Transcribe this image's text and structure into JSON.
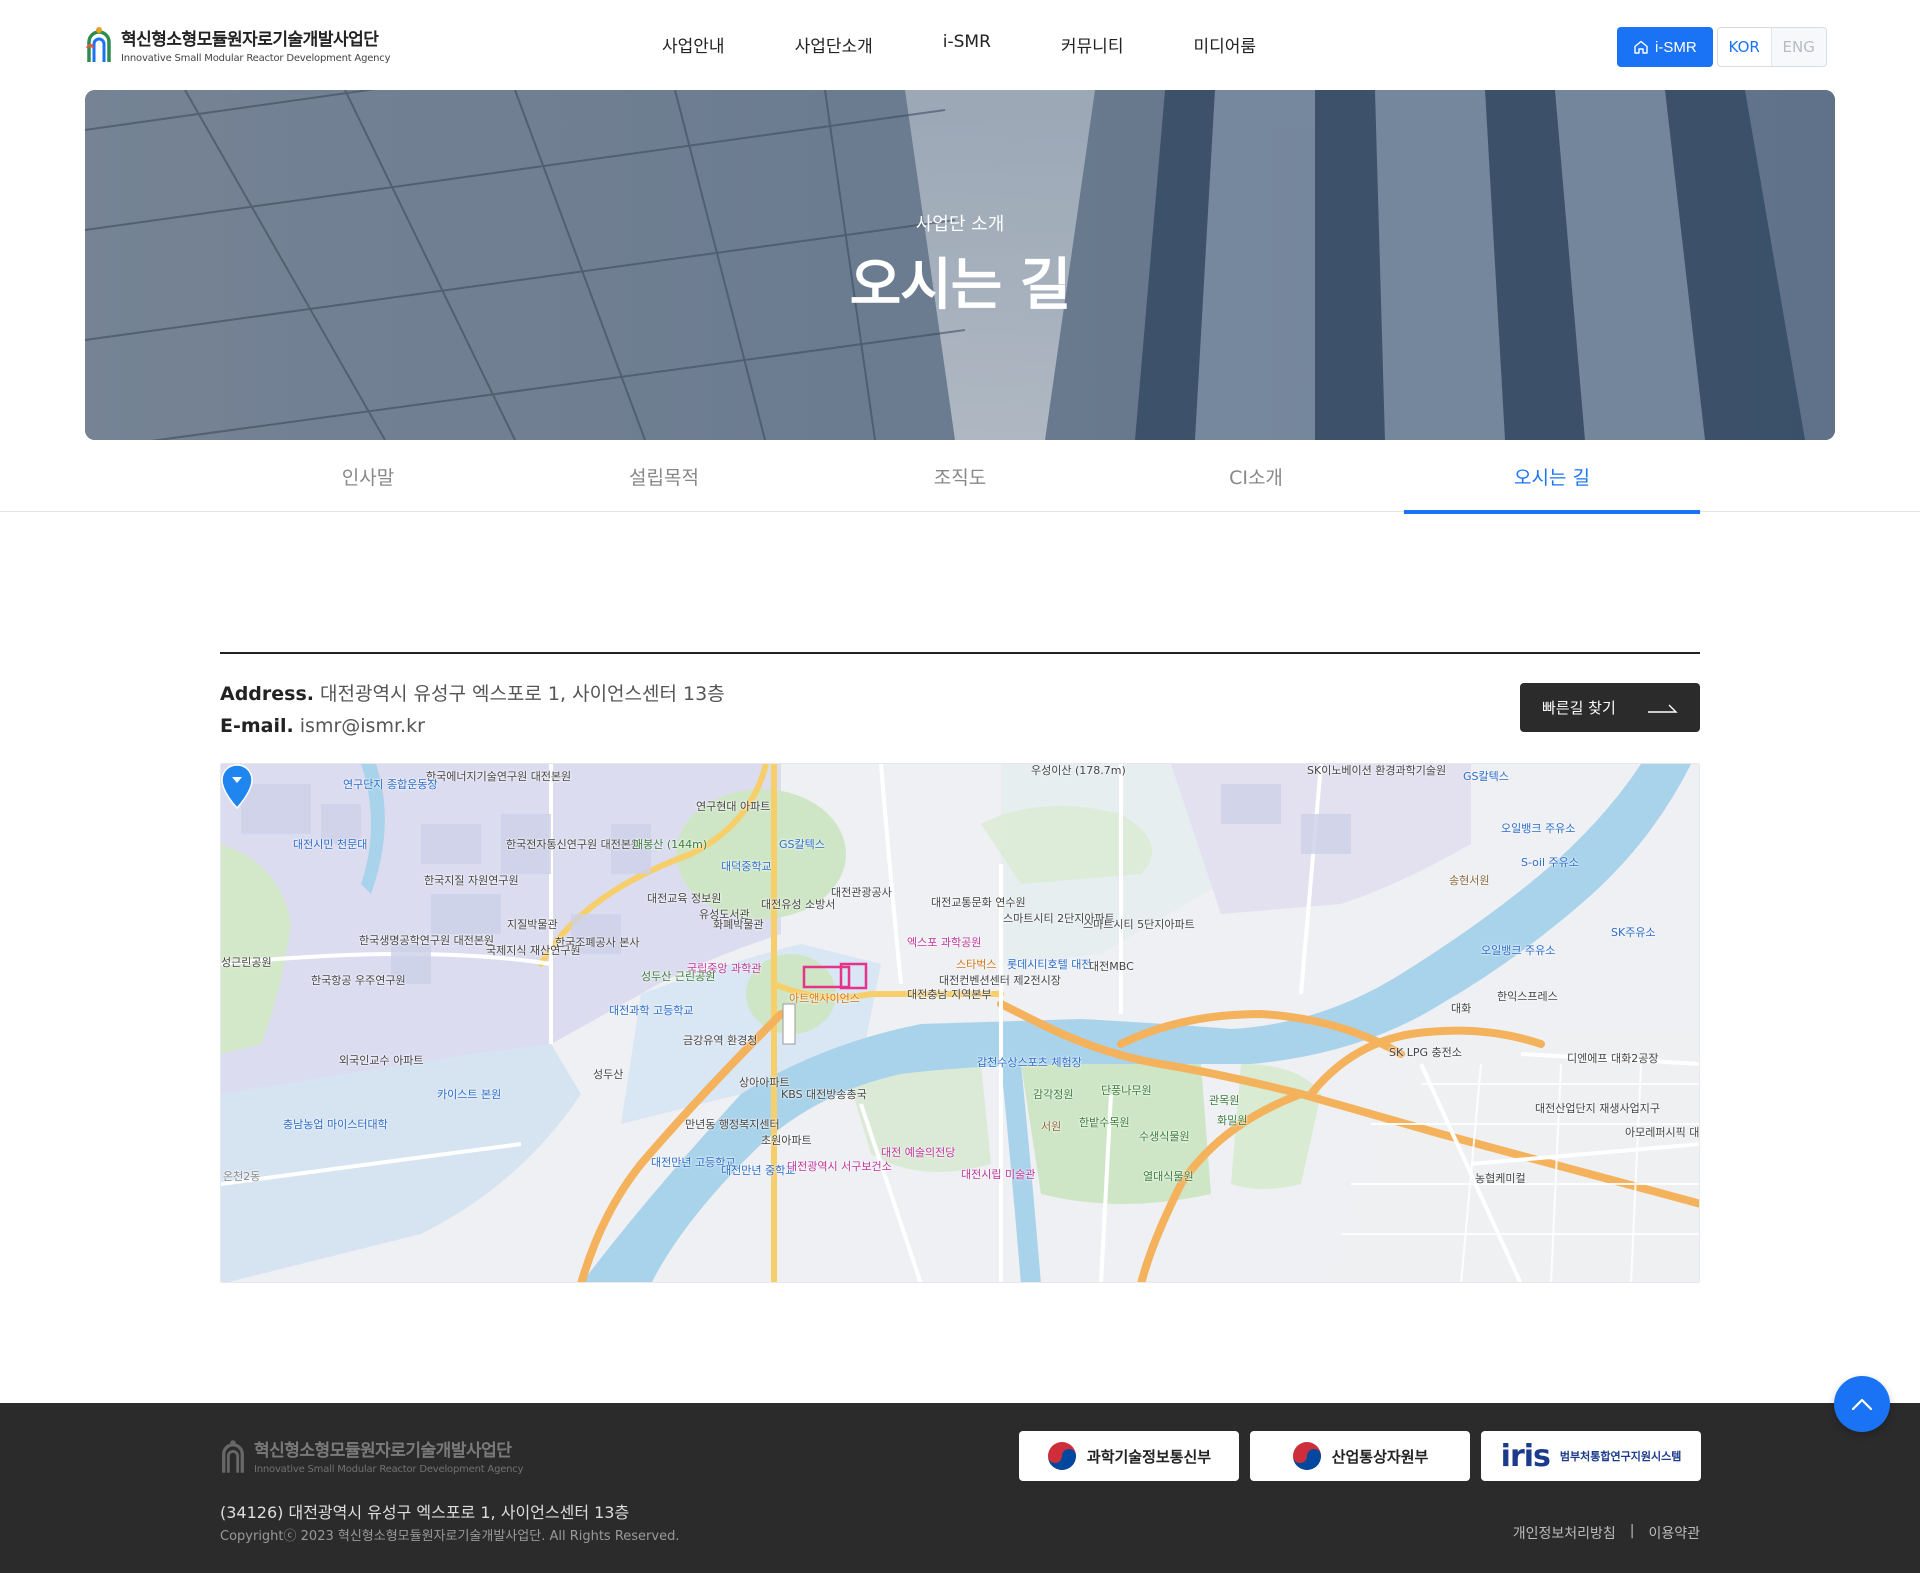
{
  "header": {
    "logo_ko": "혁신형소형모듈원자로기술개발사업단",
    "logo_en": "Innovative Small Modular Reactor Development Agency",
    "nav": [
      "사업안내",
      "사업단소개",
      "i-SMR",
      "커뮤니티",
      "미디어룸"
    ],
    "ismr_button": "i-SMR",
    "lang_kor": "KOR",
    "lang_eng": "ENG"
  },
  "hero": {
    "subtitle": "사업단 소개",
    "title": "오시는 길"
  },
  "tabs": [
    "인사말",
    "설립목적",
    "조직도",
    "CI소개",
    "오시는 길"
  ],
  "active_tab": "오시는 길",
  "contact": {
    "address_label": "Address.",
    "address_value": "대전광역시 유성구 엑스포로 1, 사이언스센터 13층",
    "email_label": "E-mail.",
    "email_value": "ismr@ismr.kr",
    "route_button": "빠른길 찾기"
  },
  "map": {
    "labels": [
      "한국에너지기술연구원 대전본원",
      "연구단지 종합운동장",
      "대전시민 천문대",
      "한국전자통신연구원 대전본원",
      "매봉산 (144m)",
      "연구현대 아파트",
      "GS칼텍스",
      "대덕중학교",
      "한국지질 자원연구원",
      "한국생명공학연구원 대전본원",
      "국제지식 재산연구원",
      "한국조폐공사 본사",
      "대전교육 정보원",
      "유성도서관",
      "대전유성 소방서",
      "대전관광공사",
      "대전교통문화 연수원",
      "스마트시티 2단지아파트",
      "스마트시티 5단지아파트",
      "엑스포 과학공원",
      "스타벅스",
      "롯데시티호텔 대전",
      "대전MBC",
      "국립중앙 과학관",
      "성두산 근린공원",
      "아트앤사이언스",
      "대전컨벤션센터 제2전시장",
      "대전충남 지역본부",
      "한국항공 우주연구원",
      "대전과학 고등학교",
      "금강유역 환경청",
      "외국인교수 아파트",
      "성두산",
      "카이스트 본원",
      "충남농업 마이스터대학",
      "상아아파트",
      "KBS 대전방송총국",
      "갑천수상스포츠 체험장",
      "단풍나무원",
      "감각정원",
      "관목원",
      "한밭수목원",
      "화밀원",
      "서원",
      "수생식물원",
      "만년동 행정복지센터",
      "초원아파트",
      "대전만년 고등학교",
      "대전만년 중학교",
      "대전광역시 서구보건소",
      "대전 예술의전당",
      "대전시립 미술관",
      "열대식물원",
      "SK LPG 충전소",
      "디엔에프 대화2공장",
      "대전산업단지 재생사업지구",
      "아모레퍼시픽 대전사업장",
      "SK주유소",
      "오일뱅크 주유소",
      "S-oil 주유소",
      "송현서원",
      "GS칼텍스",
      "SK이노베이션 환경과학기술원",
      "한익스프레스",
      "우성이산 (178.7m)",
      "오일뱅크 주유소",
      "화폐박물관",
      "지질박물관",
      "성근린공원",
      "농협케미컬",
      "온천2동",
      "대화"
    ]
  },
  "footer": {
    "logo_ko": "혁신형소형모듈원자로기술개발사업단",
    "logo_en": "Innovative Small Modular Reactor Development Agency",
    "address": "(34126) 대전광역시 유성구 엑스포로 1, 사이언스센터 13층",
    "copyright": "Copyrightⓒ 2023 혁신형소형모듈원자로기술개발사업단. All Rights Reserved.",
    "banners": [
      "과학기술정보통신부",
      "산업통상자원부",
      "iris",
      "범부처통합연구지원시스템"
    ],
    "links": [
      "개인정보처리방침",
      "|",
      "이용약관"
    ]
  },
  "colors": {
    "accent": "#1a73f5",
    "dark": "#2b2b2b"
  },
  "icons": [
    "home-icon",
    "arrow-right-icon",
    "map-pin-icon",
    "arrow-up-icon",
    "taegeuk-icon"
  ]
}
